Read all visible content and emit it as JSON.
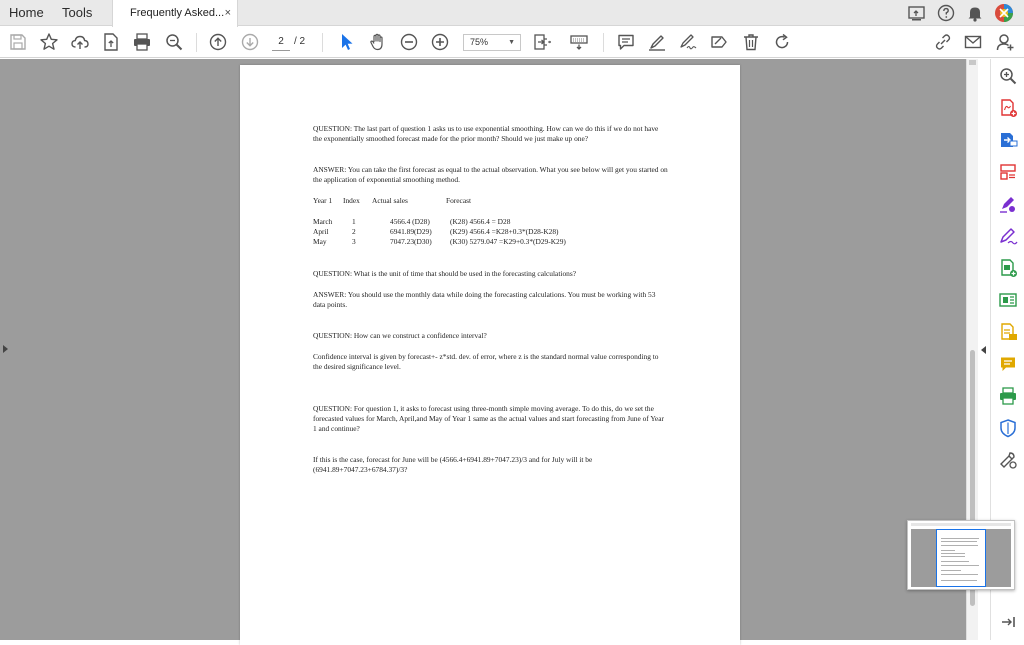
{
  "tabs": {
    "home": "Home",
    "tools": "Tools",
    "document_title": "Frequently Asked...",
    "close_glyph": "×"
  },
  "toolbar": {
    "current_page": "2",
    "page_total": "/ 2",
    "zoom": "75%"
  },
  "icons": {
    "accent_blue": "#1a73e8",
    "tool_purple": "#7a2fd0",
    "tool_green": "#2c9a4a",
    "tool_yellow": "#e0a800",
    "tool_red": "#e03434",
    "tool_blue": "#2a6fd6"
  },
  "document": {
    "q1": "QUESTION: The last part of question 1 asks us to use exponential smoothing. How can we do this if we do not have the exponentially smoothed forecast made for the prior month? Should we just make up one?",
    "a1": "ANSWER: You can take the first forecast as equal to the actual observation. What you see below will get you started on the application of exponential smoothing method.",
    "table_header": {
      "year": "Year 1",
      "index": "Index",
      "actual": "Actual sales",
      "forecast": "Forecast"
    },
    "table_rows": [
      {
        "month": "March",
        "index": "1",
        "actual": "4566.4 (D28)",
        "forecast": "(K28) 4566.4  = D28"
      },
      {
        "month": "April",
        "index": "2",
        "actual": "6941.89(D29)",
        "forecast": "(K29) 4566.4  =K28+0.3*(D28-K28)"
      },
      {
        "month": "May",
        "index": "3",
        "actual": "7047.23(D30)",
        "forecast": "(K30) 5279.047 =K29+0.3*(D29-K29)"
      }
    ],
    "q2": "QUESTION: What is the unit of time that should be used in the forecasting calculations?",
    "a2": "ANSWER: You should use the monthly data while doing the forecasting calculations. You must be working with 53 data points.",
    "q3": "QUESTION: How can we construct a confidence interval?",
    "a3": "Confidence interval is given by forecast+- z*std. dev. of error, where z is the standard normal value corresponding to the desired significance level.",
    "q4": "QUESTION: For question 1, it asks to forecast using three-month simple moving average. To do this, do we set the forecasted values for March, April,and May of Year 1 same as the actual values and start forecasting from June of Year 1 and continue?",
    "a4": "If this is the case, forecast for June will be (4566.4+6941.89+7047.23)/3 and for July will it be (6941.89+7047.23+6784.37)/3?"
  }
}
